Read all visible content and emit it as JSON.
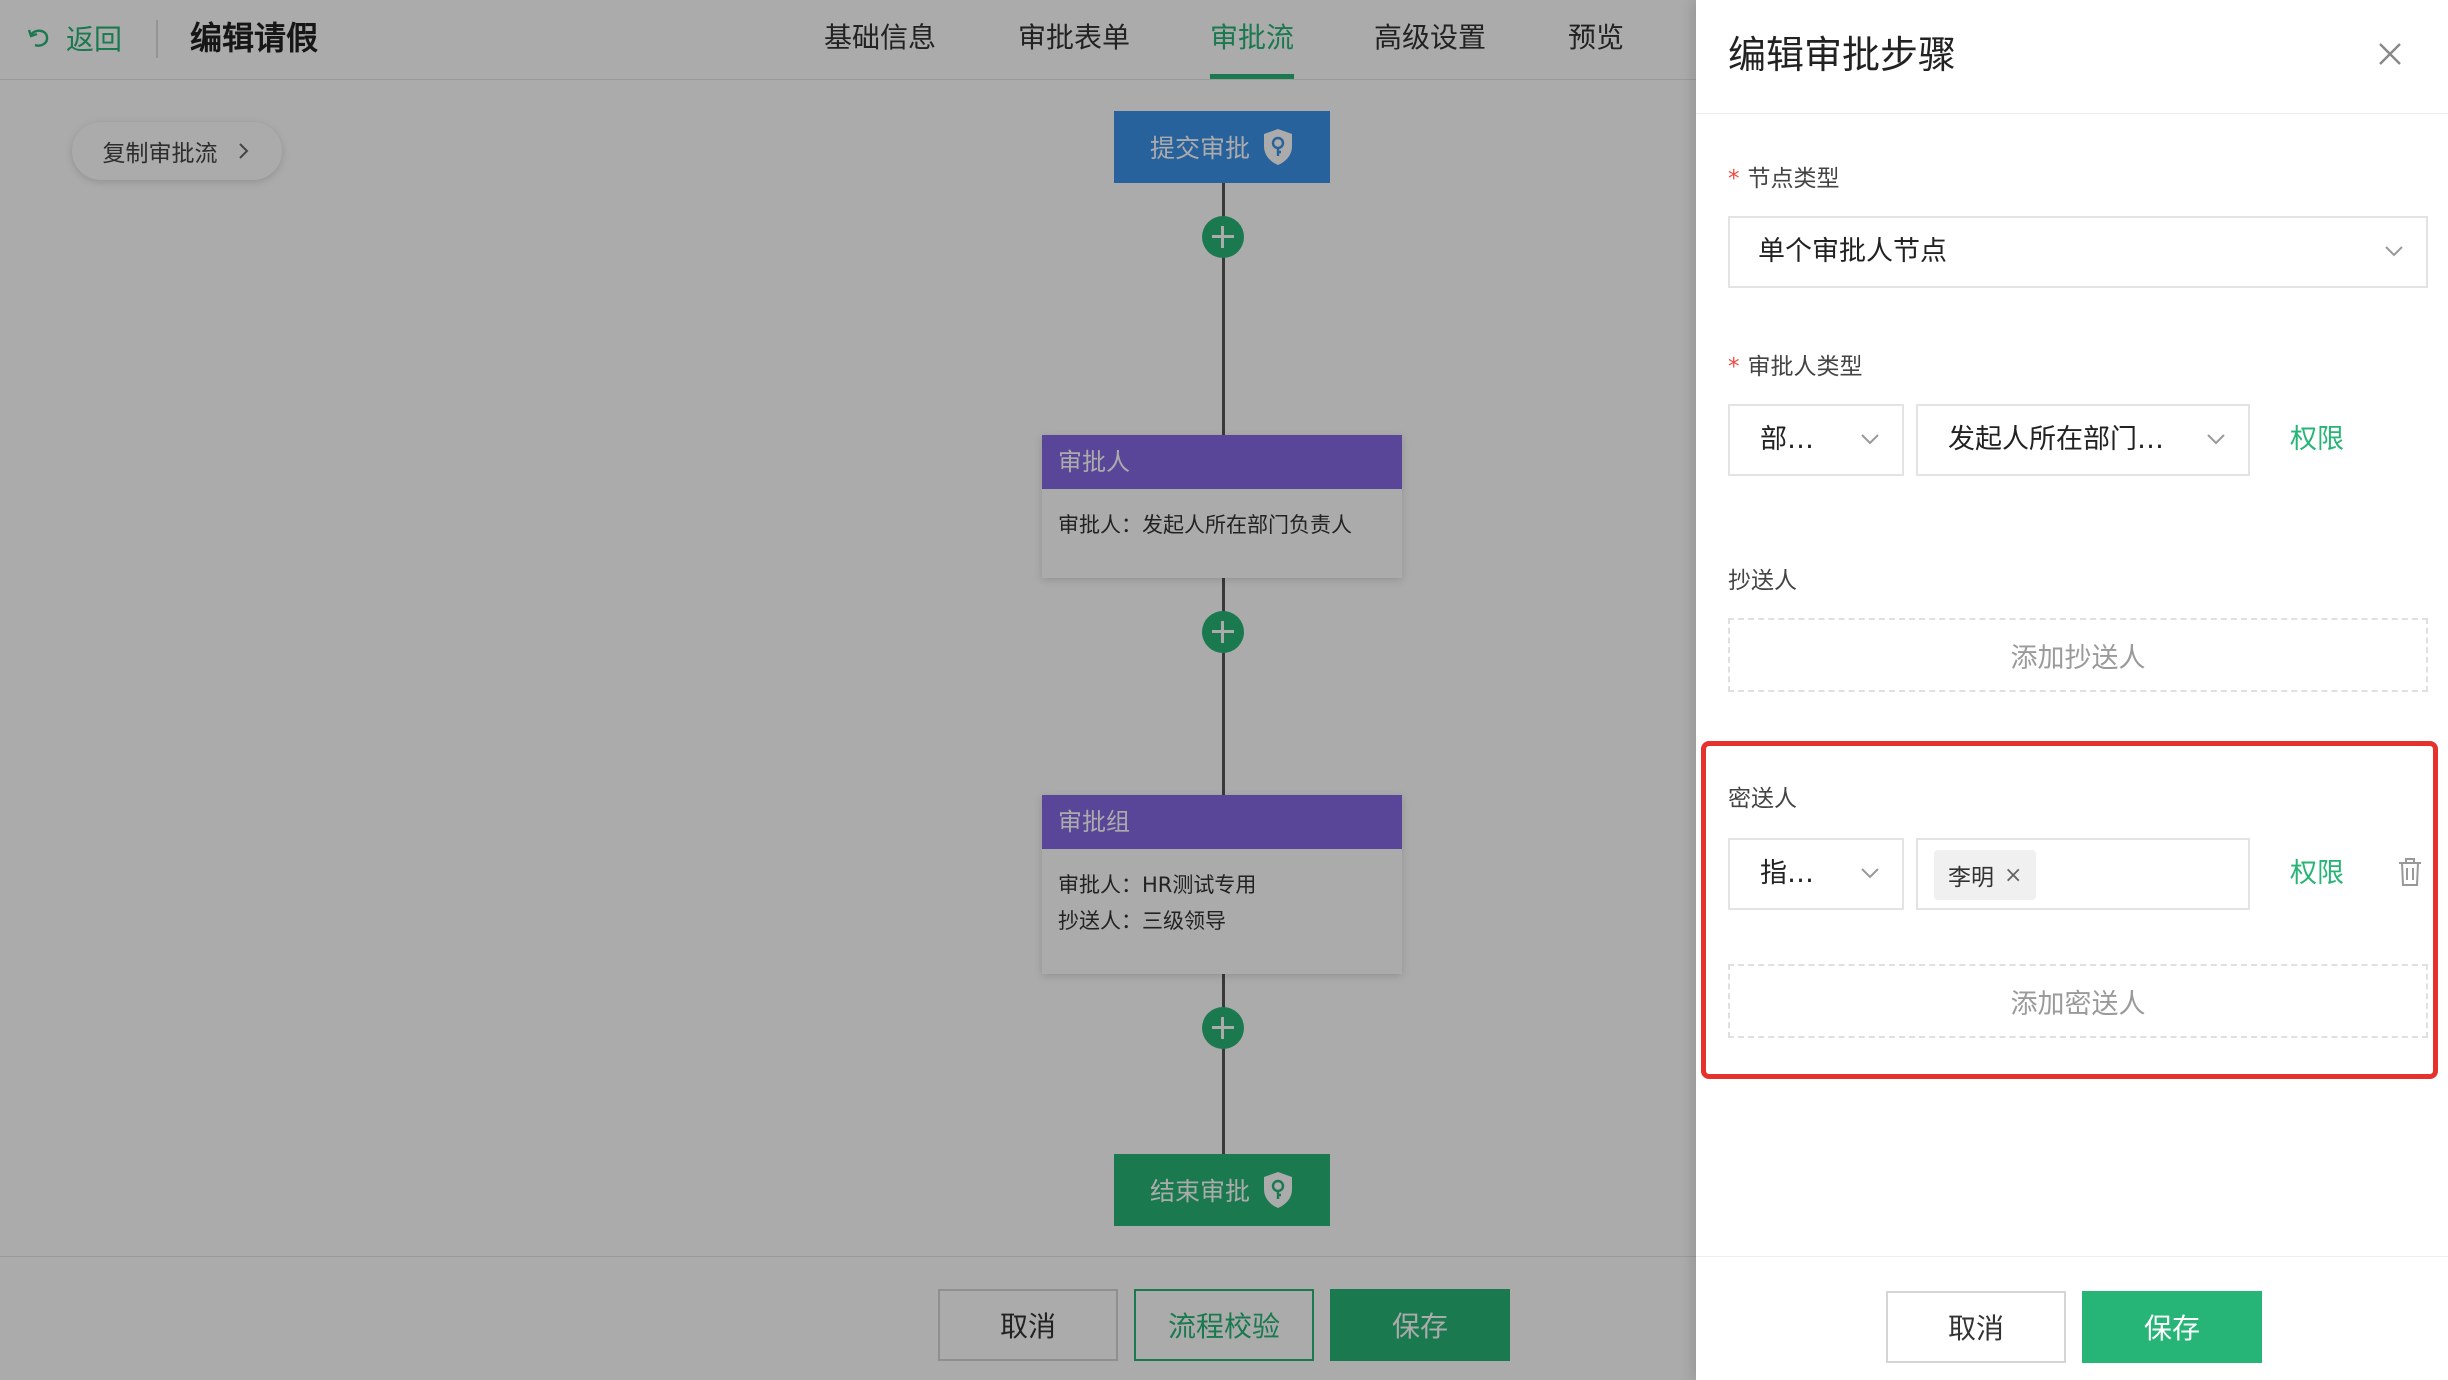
{
  "header": {
    "back_label": "返回",
    "title": "编辑请假",
    "tabs": [
      {
        "label": "基础信息",
        "active": false
      },
      {
        "label": "审批表单",
        "active": false
      },
      {
        "label": "审批流",
        "active": true
      },
      {
        "label": "高级设置",
        "active": false
      },
      {
        "label": "预览",
        "active": false
      }
    ]
  },
  "canvas": {
    "copy_flow_label": "复制审批流",
    "start_node": "提交审批",
    "end_node": "结束审批",
    "cards": [
      {
        "title": "审批人",
        "lines": [
          "审批人：发起人所在部门负责人"
        ]
      },
      {
        "title": "审批组",
        "lines": [
          "审批人：HR测试专用",
          "抄送人：三级领导"
        ]
      }
    ]
  },
  "bottom_bar": {
    "cancel": "取消",
    "validate": "流程校验",
    "save": "保存"
  },
  "drawer": {
    "title": "编辑审批步骤",
    "node_type": {
      "label": "节点类型",
      "value": "单个审批人节点"
    },
    "approver_type": {
      "label": "审批人类型",
      "type_value": "部…",
      "target_value": "发起人所在部门…",
      "permission_link": "权限"
    },
    "cc": {
      "label": "抄送人",
      "add_label": "添加抄送人"
    },
    "secret_cc": {
      "label": "密送人",
      "type_value": "指…",
      "tag": "李明",
      "tag_close": "×",
      "permission_link": "权限",
      "add_label": "添加密送人"
    },
    "footer": {
      "cancel": "取消",
      "save": "保存"
    }
  },
  "colors": {
    "accent": "#27b577",
    "start_node": "#3d92ea",
    "card_header": "#8569e5",
    "highlight": "#e5322d"
  }
}
